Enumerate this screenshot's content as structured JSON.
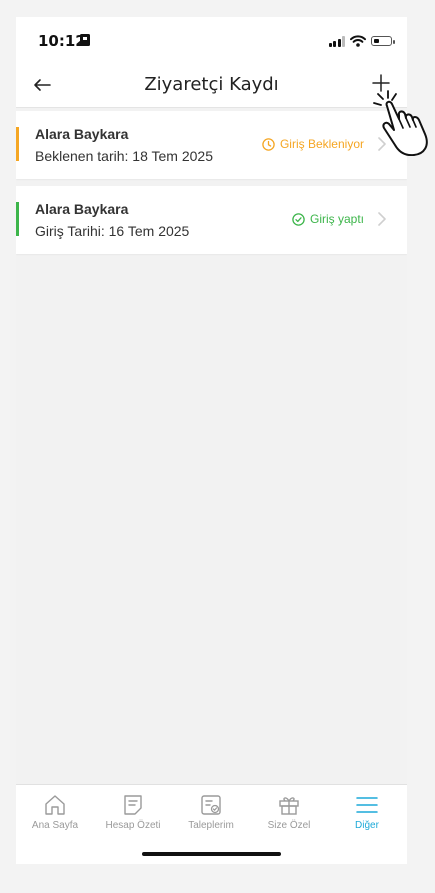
{
  "status_bar": {
    "time": "10:12"
  },
  "header": {
    "title": "Ziyaretçi Kaydı"
  },
  "visitors": [
    {
      "name": "Alara Baykara",
      "date_text": "Beklenen tarih: 18 Tem 2025",
      "status": "Giriş Bekleniyor",
      "status_color": "#f5a623",
      "accent_color": "#f5a623",
      "icon": "clock-icon"
    },
    {
      "name": "Alara Baykara",
      "date_text": "Giriş Tarihi: 16 Tem 2025",
      "status": "Giriş yaptı",
      "status_color": "#3cb54a",
      "accent_color": "#3cb54a",
      "icon": "check-circle-icon"
    }
  ],
  "tabs": [
    {
      "label": "Ana Sayfa",
      "icon": "home-icon",
      "active": false
    },
    {
      "label": "Hesap Özeti",
      "icon": "document-icon",
      "active": false
    },
    {
      "label": "Taleplerim",
      "icon": "checklist-icon",
      "active": false
    },
    {
      "label": "Size Özel",
      "icon": "gift-icon",
      "active": false
    },
    {
      "label": "Diğer",
      "icon": "menu-icon",
      "active": true
    }
  ],
  "colors": {
    "accent": "#1ca9d8",
    "inactive": "#9a9a9a"
  }
}
